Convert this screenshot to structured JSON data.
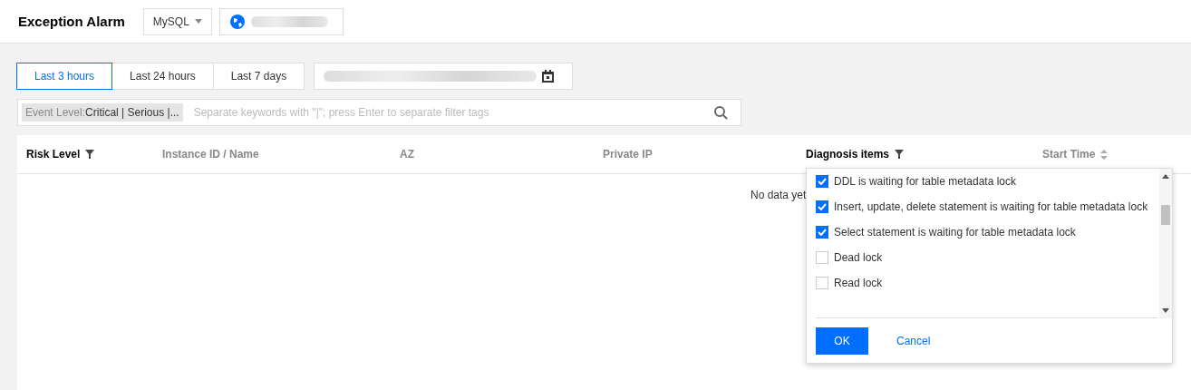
{
  "header": {
    "title": "Exception Alarm",
    "engine_select": {
      "value": "MySQL"
    }
  },
  "time_ranges": [
    {
      "label": "Last 3 hours",
      "selected": true
    },
    {
      "label": "Last 24 hours",
      "selected": false
    },
    {
      "label": "Last 7 days",
      "selected": false
    }
  ],
  "filter": {
    "tag_label": "Event Level:",
    "tag_value": "Critical | Serious |...",
    "placeholder": "Separate keywords with \"|\"; press Enter to separate filter tags"
  },
  "table": {
    "columns": [
      {
        "label": "Risk Level",
        "active": true,
        "kind": "filter"
      },
      {
        "label": "Instance ID / Name",
        "active": false,
        "kind": "plain"
      },
      {
        "label": "AZ",
        "active": false,
        "kind": "plain"
      },
      {
        "label": "Private IP",
        "active": false,
        "kind": "plain"
      },
      {
        "label": "Diagnosis items",
        "active": true,
        "kind": "filter"
      },
      {
        "label": "Start Time",
        "active": false,
        "kind": "sort"
      }
    ],
    "empty_text": "No data yet"
  },
  "diagnosis_filter": {
    "options": [
      {
        "label": "DDL is waiting for table metadata lock",
        "checked": true
      },
      {
        "label": "Insert, update, delete statement is waiting for table metadata lock",
        "checked": true
      },
      {
        "label": "Select statement is waiting for table metadata lock",
        "checked": true
      },
      {
        "label": "Dead lock",
        "checked": false
      },
      {
        "label": "Read lock",
        "checked": false
      }
    ],
    "ok": "OK",
    "cancel": "Cancel"
  }
}
